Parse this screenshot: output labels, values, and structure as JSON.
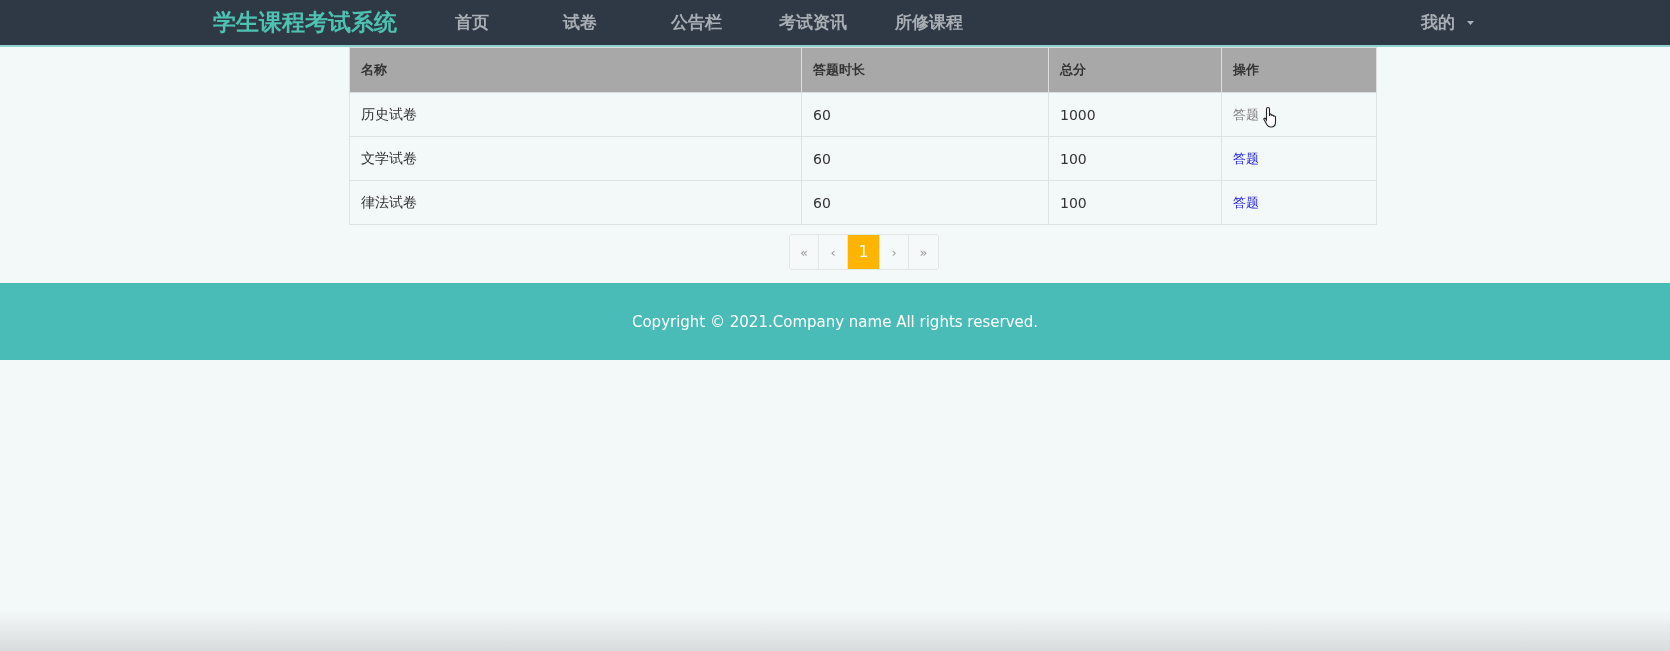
{
  "navbar": {
    "brand": "学生课程考试系统",
    "items": [
      {
        "label": "首页"
      },
      {
        "label": "试卷"
      },
      {
        "label": "公告栏"
      },
      {
        "label": "考试资讯"
      },
      {
        "label": "所修课程"
      }
    ],
    "user_menu": {
      "label": "我的"
    }
  },
  "table": {
    "columns": [
      "名称",
      "答题时长",
      "总分",
      "操作"
    ],
    "rows": [
      {
        "name": "历史试卷",
        "duration": "60",
        "total": "1000",
        "action": {
          "label": "答题",
          "hovered": true
        }
      },
      {
        "name": "文学试卷",
        "duration": "60",
        "total": "100",
        "action": {
          "label": "答题",
          "hovered": false
        }
      },
      {
        "name": "律法试卷",
        "duration": "60",
        "total": "100",
        "action": {
          "label": "答题",
          "hovered": false
        }
      }
    ]
  },
  "pagination": [
    {
      "label": "«",
      "selected": false
    },
    {
      "label": "‹",
      "selected": false
    },
    {
      "label": "1",
      "selected": true
    },
    {
      "label": "›",
      "selected": false
    },
    {
      "label": "»",
      "selected": false
    }
  ],
  "footer": {
    "text": "Copyright © 2021.Company name All rights reserved."
  }
}
